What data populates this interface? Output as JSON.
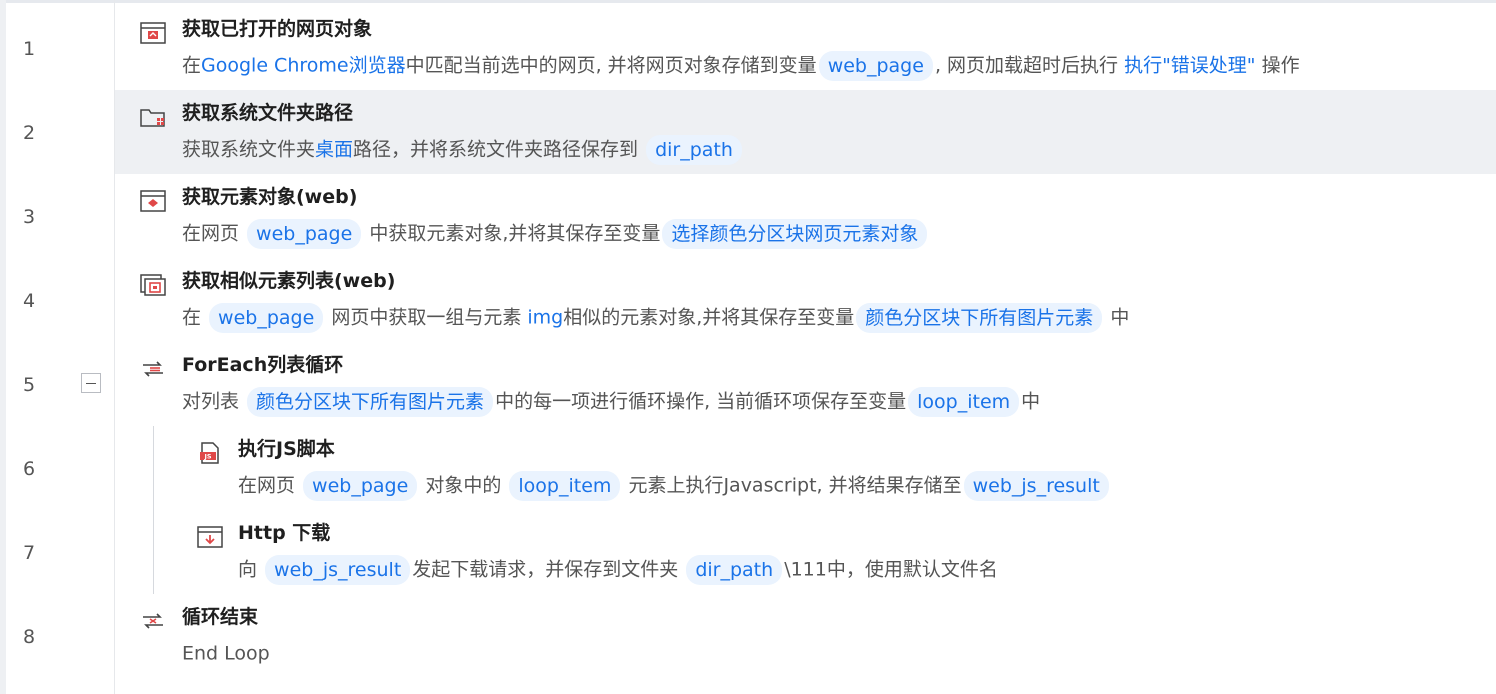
{
  "rows": [
    {
      "num": "1",
      "title": "获取已打开的网页对象",
      "desc": {
        "t1": "在",
        "b1": "Google Chrome浏览器",
        "t2": "中匹配当前选中的网页, 并将网页对象存储到变量",
        "p1": "web_page",
        "t3": ", 网页加载超时后执行 ",
        "b2": "执行\"错误处理\"",
        "t4": " 操作"
      }
    },
    {
      "num": "2",
      "title": "获取系统文件夹路径",
      "desc": {
        "t1": "获取系统文件夹",
        "b1": "桌面",
        "t2": "路径，并将系统文件夹路径保存到 ",
        "p1": "dir_path"
      }
    },
    {
      "num": "3",
      "title": "获取元素对象(web)",
      "desc": {
        "t1": "在网页 ",
        "p1": "web_page",
        "t2": " 中获取元素对象,并将其保存至变量",
        "p2": "选择颜色分区块网页元素对象"
      }
    },
    {
      "num": "4",
      "title": "获取相似元素列表(web)",
      "desc": {
        "t1": "在 ",
        "p1": "web_page",
        "t2": " 网页中获取一组与元素 ",
        "b1": "img",
        "t3": "相似的元素对象,并将其保存至变量",
        "p2": "颜色分区块下所有图片元素",
        "t4": " 中"
      }
    },
    {
      "num": "5",
      "title": "ForEach列表循环",
      "desc": {
        "t1": "对列表 ",
        "p1": "颜色分区块下所有图片元素",
        "t2": "中的每一项进行循环操作, 当前循环项保存至变量",
        "p2": "loop_item",
        "t3": "中"
      }
    },
    {
      "num": "6",
      "title": "执行JS脚本",
      "desc": {
        "t1": "在网页 ",
        "p1": "web_page",
        "t2": " 对象中的 ",
        "p2": "loop_item",
        "t3": " 元素上执行Javascript, 并将结果存储至",
        "p3": "web_js_result"
      }
    },
    {
      "num": "7",
      "title": "Http 下载",
      "desc": {
        "t1": "向 ",
        "p1": "web_js_result",
        "t2": "发起下载请求，并保存到文件夹 ",
        "p2": "dir_path",
        "t3": "\\111中，使用默认文件名"
      }
    },
    {
      "num": "8",
      "title": "循环结束",
      "desc": {
        "t1": "End Loop"
      }
    }
  ],
  "icons": [
    "browser-open-icon",
    "folder-path-icon",
    "element-object-icon",
    "similar-elements-icon",
    "foreach-loop-icon",
    "js-script-icon",
    "http-download-icon",
    "end-loop-icon"
  ],
  "colors": {
    "accent": "#1a73e8",
    "pill_bg": "#eaf3fe",
    "selected_bg": "#eef0f3",
    "icon_red": "#e04848"
  }
}
